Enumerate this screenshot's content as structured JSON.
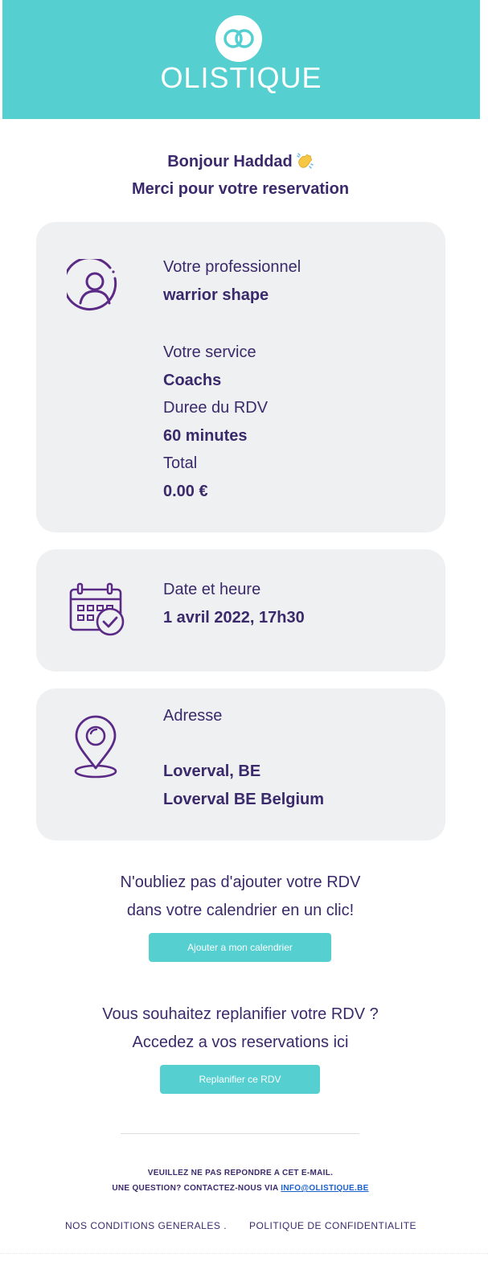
{
  "header": {
    "brand": "OLISTIQUE",
    "bg_color": "#55cfd0",
    "logo_icon": "interlocked-rings-logo"
  },
  "greeting": {
    "hello": "Bonjour Haddad",
    "emoji_icon": "waving-hand-icon",
    "thanks": "Merci pour votre reservation"
  },
  "details": {
    "icon": "user-profile-icon",
    "professional_label": "Votre professionnel",
    "professional_value": "warrior shape",
    "service_label": "Votre service",
    "service_value": "Coachs",
    "duration_label": "Duree du RDV",
    "duration_value": "60 minutes",
    "total_label": "Total",
    "total_value": "0.00 €"
  },
  "datetime": {
    "icon": "calendar-check-icon",
    "label": "Date et heure",
    "value": "1 avril 2022, 17h30"
  },
  "address": {
    "icon": "location-pin-icon",
    "label": "Adresse",
    "line1": "Loverval, BE",
    "line2": "Loverval BE Belgium"
  },
  "calendar_cta": {
    "line1": "N'oubliez pas d'ajouter votre RDV",
    "line2": "dans votre calendrier en un clic!",
    "button": "Ajouter a mon calendrier"
  },
  "replan_cta": {
    "line1": "Vous souhaitez replanifier votre RDV ?",
    "line2": "Accedez a vos reservations ici",
    "button": "Replanifier ce RDV"
  },
  "footer": {
    "no_reply": "VEUILLEZ NE PAS REPONDRE A CET E-MAIL.",
    "question": "UNE QUESTION? CONTACTEZ-NOUS VIA",
    "email": "INFO@OLISTIQUE.BE",
    "conditions": "NOS CONDITIONS GENERALES .",
    "privacy": "POLITIQUE DE CONFIDENTIALITE"
  },
  "colors": {
    "accent": "#55cfd0",
    "text": "#3b2a6b",
    "card_bg": "#eff0f1",
    "icon_stroke": "#5b2a86",
    "link": "#1a5fd0"
  }
}
